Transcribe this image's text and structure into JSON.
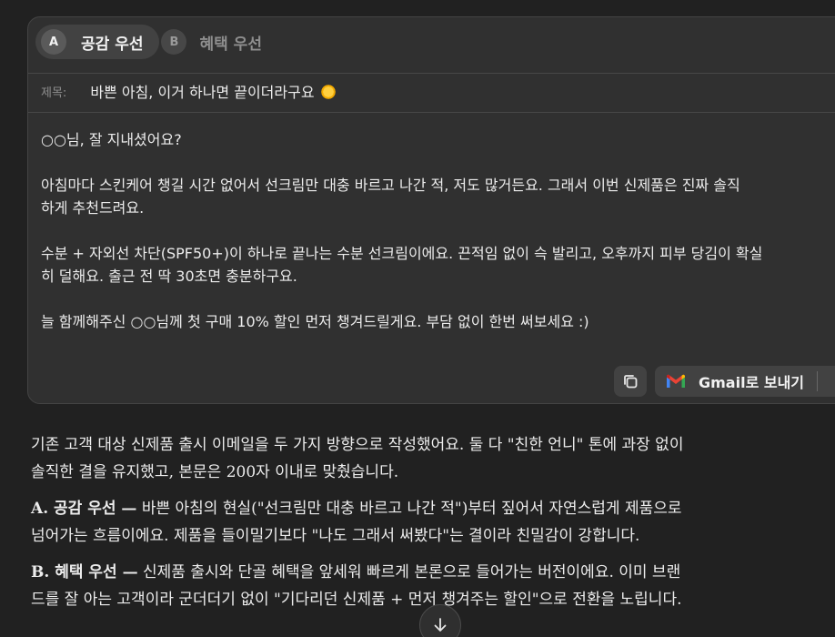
{
  "draft": {
    "tabs": [
      {
        "badge": "A",
        "label": "공감 우선",
        "active": true
      },
      {
        "badge": "B",
        "label": "혜택 우선",
        "active": false
      }
    ],
    "subject_label": "제목:",
    "subject": "바쁜 아침, 이거 하나면 끝이더라구요",
    "subject_icon": "sun-emoji-icon",
    "body": [
      "○○님, 잘 지내셨어요?",
      "아침마다 스킨케어 챙길 시간 없어서 선크림만 대충 바르고 나간 적, 저도 많거든요. 그래서 이번 신제품은 진짜 솔직",
      "하게 추천드려요.",
      "수분 + 자외선 차단(SPF50+)이 하나로 끝나는 수분 선크림이에요. 끈적임 없이 슥 발리고, 오후까지 피부 당김이 확실",
      "히 덜해요. 출근 전 딱 30초면 충분하구요.",
      "늘 함께해주신 ○○님께 첫 구매 10% 할인 먼저 챙겨드릴게요. 부담 없이 한번 써보세요 :)"
    ],
    "actions": {
      "copy_icon": "copy-icon",
      "gmail_label": "Gmail로 보내기",
      "gmail_icon": "gmail-icon"
    }
  },
  "response": {
    "intro_line1": "기존 고객 대상 신제품 출시 이메일을 두 가지 방향으로 작성했어요. 둘 다 \"친한 언니\" 톤에 과장 없이",
    "intro_line2": "솔직한 결을 유지했고, 본문은 200자 이내로 맞췄습니다.",
    "a_title": "A. 공감 우선 —",
    "a_line1": " 바쁜 아침의 현실(\"선크림만 대충 바르고 나간 적\")부터 짚어서 자연스럽게 제품으로",
    "a_line2": "넘어가는 흐름이에요. 제품을 들이밀기보다 \"나도 그래서 써봤다\"는 결이라 친밀감이 강합니다.",
    "b_title": "B. 혜택 우선 —",
    "b_line1": " 신제품 출시와 단골 혜택을 앞세워 빠르게 본론으로 들어가는 버전이에요. 이미 브랜",
    "b_line2": "드를 잘 아는 고객이라 군더더기 없이 \"기다리던 신제품 + 먼저 챙겨주는 할인\"으로 전환을 노립니다."
  },
  "scroll_icon": "arrow-down-icon",
  "colors": {
    "background": "#212121",
    "card": "#303030",
    "button": "#424242"
  }
}
